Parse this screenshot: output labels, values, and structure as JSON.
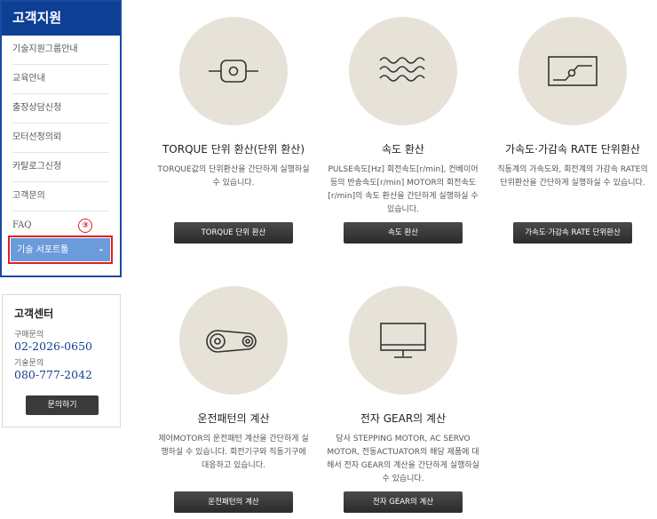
{
  "sidebar": {
    "title": "고객지원",
    "items": [
      {
        "label": "기술지원그룹안내"
      },
      {
        "label": "교육안내"
      },
      {
        "label": "출장상담신청"
      },
      {
        "label": "모터선정의뢰"
      },
      {
        "label": "카탈로그신청"
      },
      {
        "label": "고객문의"
      },
      {
        "label": "FAQ"
      }
    ],
    "active_item": {
      "label": "기술 서포트툴",
      "marker": "-"
    },
    "annotation": "③"
  },
  "customer_center": {
    "title": "고객센터",
    "sales_label": "구매문의",
    "sales_phone": "02-2026-0650",
    "tech_label": "기술문의",
    "tech_phone": "080-777-2042",
    "button_label": "문의하기"
  },
  "cards": [
    {
      "icon": "torque-icon",
      "title": "TORQUE 단위 환산(단위 환산)",
      "description": "TORQUE값의 단위환산을 간단하게 실행하실 수 있습니다.",
      "button_label": "TORQUE 단위 환산"
    },
    {
      "icon": "speed-wave-icon",
      "title": "속도 환산",
      "description": "PULSE속도[Hz] 회전속도[r/min], 컨베이어 등의 반송속도[r/min] MOTOR의 회전속도[r/min]의 속도 환산을 간단하게 실행하실 수 있습니다.",
      "button_label": "속도 환산"
    },
    {
      "icon": "acceleration-graph-icon",
      "title": "가속도·가감속 RATE 단위환산",
      "description": "직동계의 가속도와, 회전계의 가감속 RATE의 단위환산을 간단하게 실행하실 수 있습니다.",
      "button_label": "가속도·가감속 RATE 단위환산"
    },
    {
      "icon": "belt-pulley-icon",
      "title": "운전패턴의 계산",
      "description": "제어MOTOR의 운전패턴 계산을 간단하게 실행하실 수 있습니다. 회전기구와 직동기구에 대응하고 있습니다.",
      "button_label": "운전패턴의 계산"
    },
    {
      "icon": "monitor-icon",
      "title": "전자 GEAR의 계산",
      "description": "당사 STEPPING MOTOR, AC SERVO MOTOR, 전동ACTUATOR의 해당 제품에 대해서 전자 GEAR의 계산을 간단하게 실행하실 수 있습니다.",
      "button_label": "전자 GEAR의 계산"
    }
  ],
  "colors": {
    "sidebar_header": "#0d3f94",
    "active_item": "#6c9bdc",
    "highlight_border": "#e02020",
    "circle_bg": "#e7e2d8",
    "button_bg": "#333333"
  }
}
